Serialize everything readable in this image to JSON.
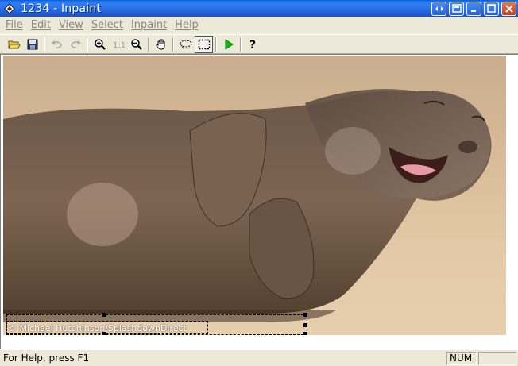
{
  "window": {
    "title": "1234 - Inpaint",
    "app_icon": "inpaint-diamond-icon",
    "controls": [
      "resize-arrows-icon",
      "restore-pages-icon",
      "minimize-icon",
      "maximize-icon",
      "close-icon"
    ]
  },
  "menu": {
    "items": [
      {
        "label": "File"
      },
      {
        "label": "Edit"
      },
      {
        "label": "View"
      },
      {
        "label": "Select"
      },
      {
        "label": "Inpaint"
      },
      {
        "label": "Help"
      }
    ]
  },
  "toolbar": {
    "tools": [
      "open-folder-icon",
      "save-disk-icon",
      "undo-icon",
      "redo-icon",
      "zoom-in-icon",
      "actual-size-icon",
      "zoom-out-icon",
      "hand-pan-icon",
      "lasso-icon",
      "rect-select-icon",
      "run-inpaint-icon",
      "help-icon"
    ],
    "active_tool": "rect-select-icon"
  },
  "canvas": {
    "image_credit": "© Michael Hutchinson/SplashdownDirect"
  },
  "status": {
    "help_text": "For Help, press F1",
    "num_indicator": "NUM",
    "extra_pane": ""
  },
  "colors": {
    "titlebar": "#2f76ea",
    "chrome": "#ece9d8",
    "run_green": "#12b312"
  }
}
